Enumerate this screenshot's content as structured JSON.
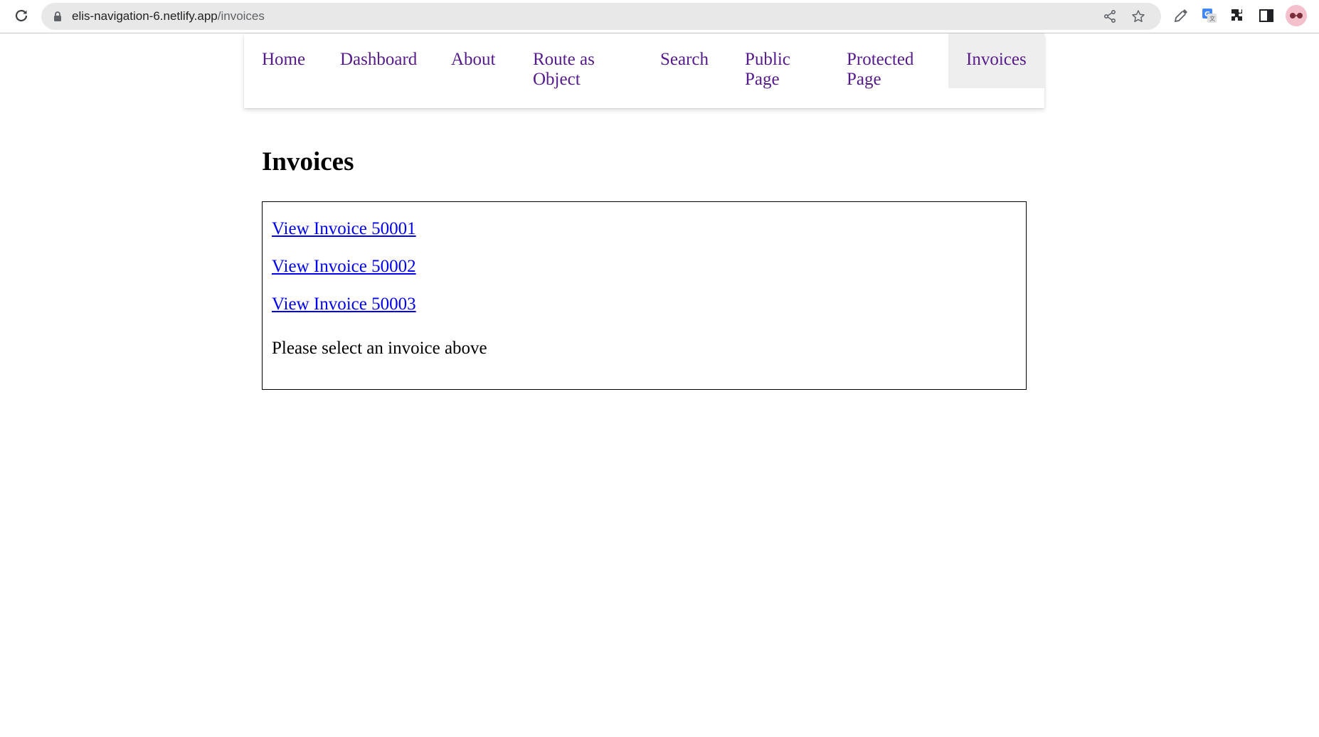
{
  "browser": {
    "url_host": "elis-navigation-6.netlify.app",
    "url_path": "/invoices",
    "icons": [
      "reload-icon",
      "lock-icon",
      "share-icon",
      "star-icon",
      "eyedropper-icon",
      "translate-icon",
      "extensions-icon",
      "side-panel-icon",
      "profile-avatar"
    ]
  },
  "nav": {
    "items": [
      {
        "label": "Home"
      },
      {
        "label": "Dashboard"
      },
      {
        "label": "About"
      },
      {
        "label": "Route as Object"
      },
      {
        "label": "Search"
      },
      {
        "label": "Public Page"
      },
      {
        "label": "Protected Page"
      },
      {
        "label": "Invoices",
        "active": true
      }
    ]
  },
  "main": {
    "title": "Invoices",
    "invoices": [
      {
        "label": "View Invoice 50001"
      },
      {
        "label": "View Invoice 50002"
      },
      {
        "label": "View Invoice 50003"
      }
    ],
    "message": "Please select an invoice above"
  },
  "colors": {
    "nav_link": "#551a8b",
    "active_bg": "#eeeeee",
    "link": "#0000ee"
  }
}
